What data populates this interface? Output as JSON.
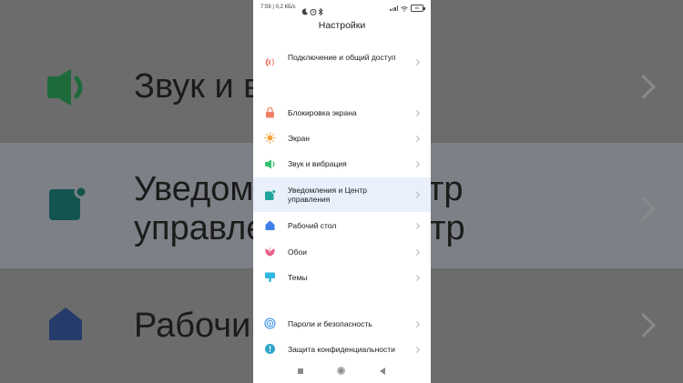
{
  "status_bar": {
    "text": "7:59 | 0,2 КБ/с",
    "battery_level": "80",
    "icons": [
      "moon-icon",
      "alarm-icon",
      "bluetooth-icon",
      "signal-icon",
      "wifi-icon",
      "battery-icon"
    ]
  },
  "screen": {
    "title": "Настройки",
    "items": [
      {
        "label": "Подключение и общий доступ",
        "icon": "connection-icon",
        "color": "#e8604b"
      },
      {
        "label": "Блокировка экрана",
        "icon": "lock-icon",
        "color": "#f07f63"
      },
      {
        "label": "Экран",
        "icon": "sun-icon",
        "color": "#f3a33a"
      },
      {
        "label": "Звук и вибрация",
        "icon": "speaker-icon",
        "color": "#32c06e"
      },
      {
        "label": "Уведомления и Центр управления",
        "icon": "notification-icon",
        "color": "#1fa59b"
      },
      {
        "label": "Рабочий стол",
        "icon": "home-icon",
        "color": "#3f7ee8"
      },
      {
        "label": "Обои",
        "icon": "flower-icon",
        "color": "#e8638a"
      },
      {
        "label": "Темы",
        "icon": "theme-icon",
        "color": "#2fb6e0"
      },
      {
        "label": "Пароли и безопасность",
        "icon": "fingerprint-icon",
        "color": "#3a8fe6"
      },
      {
        "label": "Защита конфиденциальности",
        "icon": "privacy-icon",
        "color": "#2da4c9"
      }
    ]
  },
  "background": {
    "labels": [
      "Звук и ви",
      "Уведомл",
      "управле",
      "Рабочий",
      "тр",
      "ентр"
    ]
  },
  "nav": {
    "icons": [
      "recents-icon",
      "home-button-icon",
      "back-icon"
    ]
  }
}
